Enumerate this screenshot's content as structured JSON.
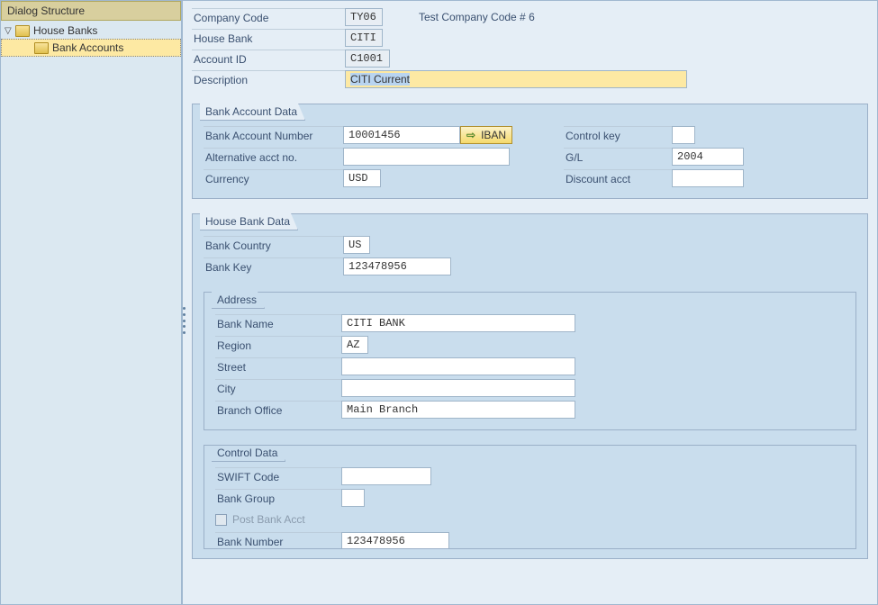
{
  "sidebar": {
    "title": "Dialog Structure",
    "items": [
      {
        "label": "House Banks"
      },
      {
        "label": "Bank Accounts"
      }
    ]
  },
  "header": {
    "company_code_label": "Company Code",
    "company_code": "TY06",
    "company_text": "Test Company Code # 6",
    "house_bank_label": "House Bank",
    "house_bank": "CITI",
    "account_id_label": "Account ID",
    "account_id": "C1001",
    "description_label": "Description",
    "description": "CITI Current"
  },
  "bank_account_data": {
    "title": "Bank Account Data",
    "bank_account_number_label": "Bank Account Number",
    "bank_account_number": "10001456",
    "iban_button": "IBAN",
    "control_key_label": "Control key",
    "control_key": "",
    "alt_acct_label": "Alternative acct no.",
    "alt_acct": "",
    "gl_label": "G/L",
    "gl": "2004",
    "currency_label": "Currency",
    "currency": "USD",
    "discount_label": "Discount acct",
    "discount": ""
  },
  "house_bank_data": {
    "title": "House Bank Data",
    "bank_country_label": "Bank Country",
    "bank_country": "US",
    "bank_key_label": "Bank Key",
    "bank_key": "123478956"
  },
  "address": {
    "title": "Address",
    "bank_name_label": "Bank Name",
    "bank_name": "CITI BANK",
    "region_label": "Region",
    "region": "AZ",
    "street_label": "Street",
    "street": "",
    "city_label": "City",
    "city": "",
    "branch_label": "Branch Office",
    "branch": "Main Branch"
  },
  "control_data": {
    "title": "Control Data",
    "swift_label": "SWIFT Code",
    "swift": "",
    "bank_group_label": "Bank Group",
    "bank_group": "",
    "post_bank_label": "Post Bank Acct",
    "bank_number_label": "Bank Number",
    "bank_number": "123478956"
  }
}
